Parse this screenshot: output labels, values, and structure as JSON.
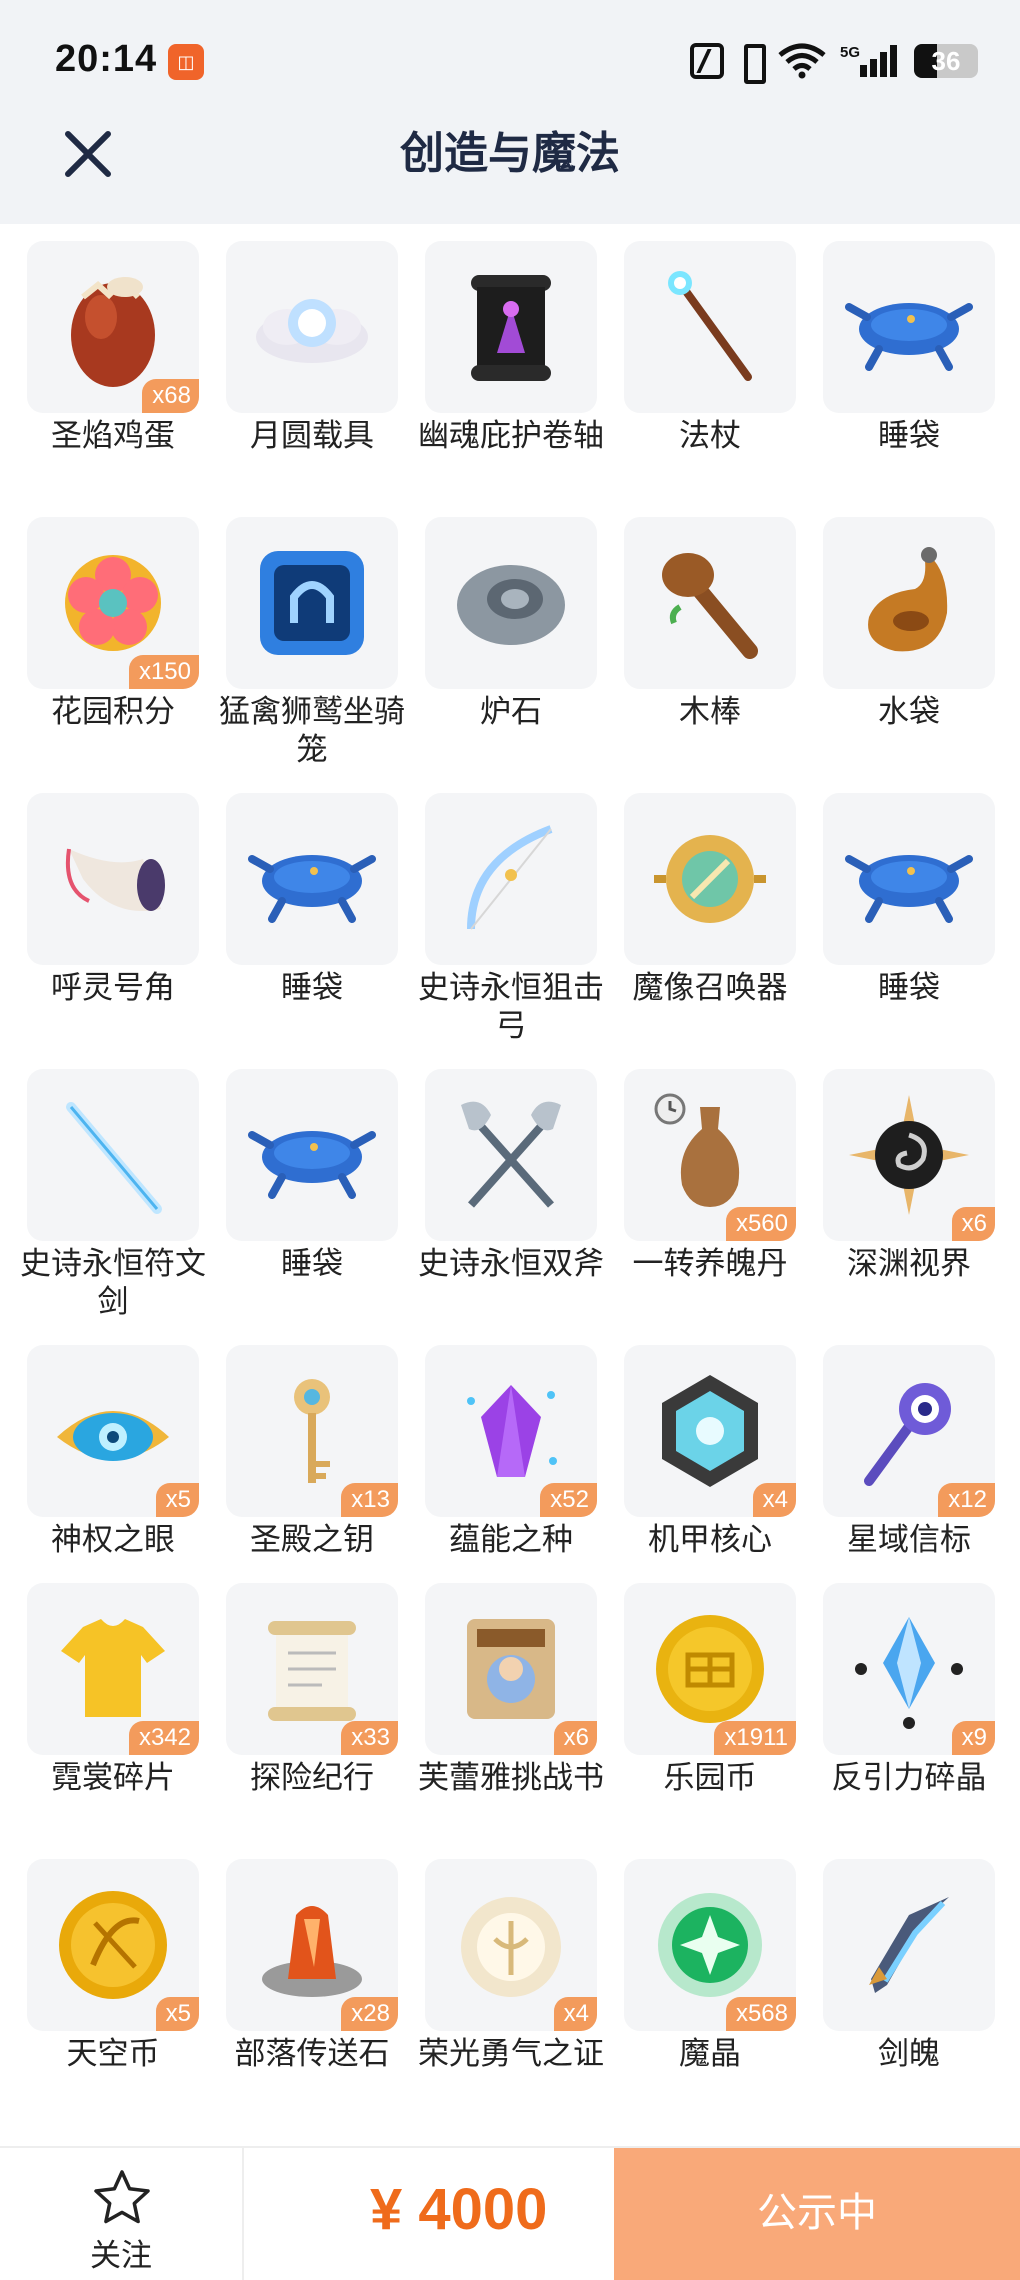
{
  "status_bar": {
    "time": "20:14",
    "app_icon": "bilibili-icon",
    "network": "5G",
    "battery": "36"
  },
  "header": {
    "title": "创造与魔法",
    "close_icon": "close-icon"
  },
  "items": [
    {
      "label": "圣焰鸡蛋",
      "count": "x68",
      "icon": "egg-icon"
    },
    {
      "label": "月圆载具",
      "count": "",
      "icon": "moon-cloud-icon"
    },
    {
      "label": "幽魂庇护卷轴",
      "count": "",
      "icon": "scroll-icon"
    },
    {
      "label": "法杖",
      "count": "",
      "icon": "staff-icon"
    },
    {
      "label": "睡袋",
      "count": "",
      "icon": "sleeping-bag-icon"
    },
    {
      "label": "花园积分",
      "count": "x150",
      "icon": "flower-icon"
    },
    {
      "label": "猛禽狮鹫坐骑笼",
      "count": "",
      "icon": "cage-icon"
    },
    {
      "label": "炉石",
      "count": "",
      "icon": "hearthstone-icon"
    },
    {
      "label": "木棒",
      "count": "",
      "icon": "club-icon"
    },
    {
      "label": "水袋",
      "count": "",
      "icon": "water-bag-icon"
    },
    {
      "label": "呼灵号角",
      "count": "",
      "icon": "horn-icon"
    },
    {
      "label": "睡袋",
      "count": "",
      "icon": "sleeping-bag-icon"
    },
    {
      "label": "史诗永恒狙击弓",
      "count": "",
      "icon": "bow-icon"
    },
    {
      "label": "魔像召唤器",
      "count": "",
      "icon": "summoner-icon"
    },
    {
      "label": "睡袋",
      "count": "",
      "icon": "sleeping-bag-icon"
    },
    {
      "label": "史诗永恒符文剑",
      "count": "",
      "icon": "sword-icon"
    },
    {
      "label": "睡袋",
      "count": "",
      "icon": "sleeping-bag-icon"
    },
    {
      "label": "史诗永恒双斧",
      "count": "",
      "icon": "axes-icon"
    },
    {
      "label": "一转养魄丹",
      "count": "x560",
      "icon": "vase-icon"
    },
    {
      "label": "深渊视界",
      "count": "x6",
      "icon": "abyss-icon"
    },
    {
      "label": "神权之眼",
      "count": "x5",
      "icon": "eye-icon"
    },
    {
      "label": "圣殿之钥",
      "count": "x13",
      "icon": "key-icon"
    },
    {
      "label": "蕴能之种",
      "count": "x52",
      "icon": "crystal-icon"
    },
    {
      "label": "机甲核心",
      "count": "x4",
      "icon": "mech-core-icon"
    },
    {
      "label": "星域信标",
      "count": "x12",
      "icon": "beacon-icon"
    },
    {
      "label": "霓裳碎片",
      "count": "x342",
      "icon": "shirt-icon"
    },
    {
      "label": "探险纪行",
      "count": "x33",
      "icon": "scroll-paper-icon"
    },
    {
      "label": "芙蕾雅挑战书",
      "count": "x6",
      "icon": "wanted-poster-icon"
    },
    {
      "label": "乐园币",
      "count": "x1911",
      "icon": "gold-coin-icon"
    },
    {
      "label": "反引力碎晶",
      "count": "x9",
      "icon": "antigravity-icon"
    },
    {
      "label": "天空币",
      "count": "x5",
      "icon": "sky-coin-icon"
    },
    {
      "label": "部落传送石",
      "count": "x28",
      "icon": "teleport-stone-icon"
    },
    {
      "label": "荣光勇气之证",
      "count": "x4",
      "icon": "emblem-icon"
    },
    {
      "label": "魔晶",
      "count": "x568",
      "icon": "magic-crystal-icon"
    },
    {
      "label": "剑魄",
      "count": "",
      "icon": "sword-soul-icon"
    }
  ],
  "bottom_bar": {
    "follow_label": "关注",
    "price": "¥ 4000",
    "publicity_label": "公示中"
  },
  "colors": {
    "accent": "#ef6b1b",
    "badge": "#f39b5c",
    "publicity_button": "#f9a979",
    "title": "#1f2a44"
  }
}
